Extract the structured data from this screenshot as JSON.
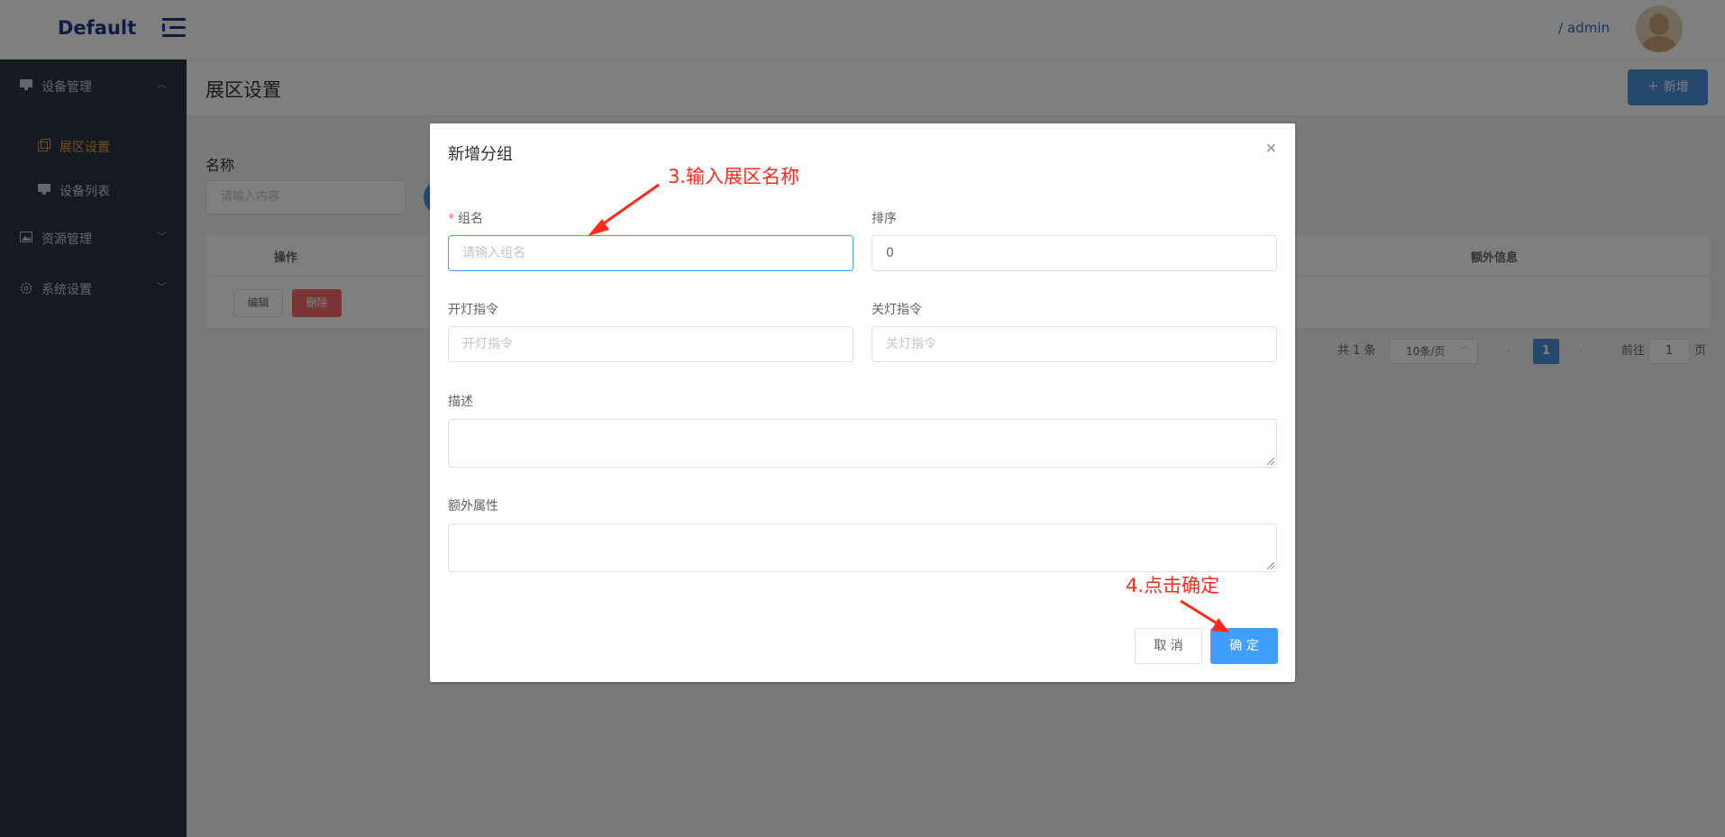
{
  "header": {
    "brand": "Default",
    "user": "/ admin"
  },
  "sidebar": {
    "groups": [
      {
        "label": "设备管理",
        "icon": "monitor-icon",
        "expanded": true,
        "items": [
          {
            "label": "展区设置",
            "icon": "copy-icon",
            "active": true
          },
          {
            "label": "设备列表",
            "icon": "monitor-icon",
            "active": false
          }
        ]
      },
      {
        "label": "资源管理",
        "icon": "image-icon",
        "expanded": false
      },
      {
        "label": "系统设置",
        "icon": "gear-icon",
        "expanded": false
      }
    ]
  },
  "page": {
    "title": "展区设置",
    "add_button": "＋ 新增",
    "filter_label": "名称",
    "filter_placeholder": "请输入内容"
  },
  "table": {
    "columns": [
      "操作",
      "额外信息"
    ],
    "row_actions": {
      "edit": "编辑",
      "delete": "删除"
    }
  },
  "pagination": {
    "total": "共 1 条",
    "page_size": "10条/页",
    "current_page": "1",
    "goto_label": "前往",
    "goto_value": "1",
    "page_suffix": "页"
  },
  "dialog": {
    "title": "新增分组",
    "fields": {
      "group_name": {
        "label": "组名",
        "required": true,
        "placeholder": "请输入组名",
        "value": ""
      },
      "sort": {
        "label": "排序",
        "value": "0"
      },
      "light_on": {
        "label": "开灯指令",
        "placeholder": "开灯指令"
      },
      "light_off": {
        "label": "关灯指令",
        "placeholder": "关灯指令"
      },
      "description": {
        "label": "描述"
      },
      "extra": {
        "label": "额外属性"
      }
    },
    "cancel": "取 消",
    "confirm": "确 定"
  },
  "annotations": {
    "step3": "3.输入展区名称",
    "step4": "4.点击确定",
    "color": "#ff2a1a"
  },
  "colors": {
    "sidebar_bg": "#2b3444",
    "accent": "#409eff",
    "active_menu": "#e6a23c",
    "danger": "#f56c6c"
  }
}
